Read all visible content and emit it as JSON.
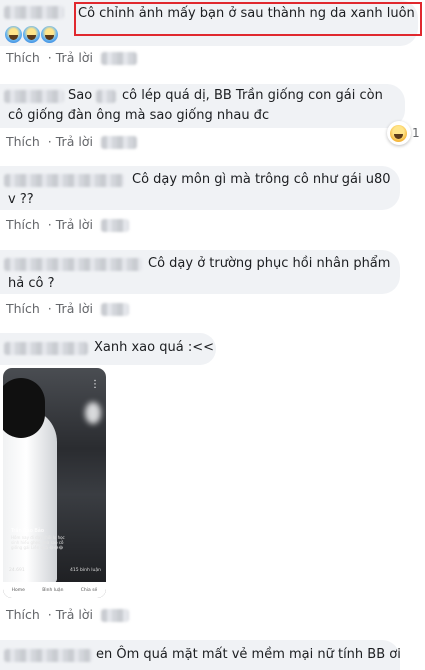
{
  "comments": [
    {
      "text": "Cô chỉnh ảnh mấy bạn ở sau thành ng da xanh luôn",
      "like": "Thích",
      "reply": "Trả lời"
    },
    {
      "text_a": "Sao",
      "text_b": "cô lép quá dị, BB Trần giống con gái còn cô giống đàn ông mà sao giống nhau đc",
      "like": "Thích",
      "reply": "Trả lời"
    },
    {
      "text": "Cô dạy môn gì mà trông cô như gái u80 v ??",
      "like": "Thích",
      "reply": "Trả lời"
    },
    {
      "text": "Cô dạy ở trường phục hồi nhân phẩm hả cô ?",
      "like": "Thích",
      "reply": "Trả lời"
    },
    {
      "text": "Xanh xao quá :<<",
      "like": "Thích",
      "reply": "Trả lời"
    },
    {
      "text": "en Ôm quá mặt mất vẻ mềm mại nữ tính BB ơi"
    }
  ],
  "video": {
    "author": "Trần Bảo Bảo",
    "caption": "Hôm nay đi dạy thôi lo học sinh hiểu ghẹo, mà sao cô giống gái Liên quá 😂😂😂",
    "likes": "24.691",
    "shares": "415 bình luận",
    "tab_home": "Home",
    "tab_comment": "Bình luận",
    "tab_share": "Chia sẻ"
  },
  "icons": {
    "emoji": "cold-face-emoji",
    "reaction": "haha-reaction-icon",
    "menu": "more-options-icon"
  },
  "colors": {
    "highlight": "#e0282e",
    "bubble": "#f0f2f5",
    "action_text": "#65676b"
  }
}
